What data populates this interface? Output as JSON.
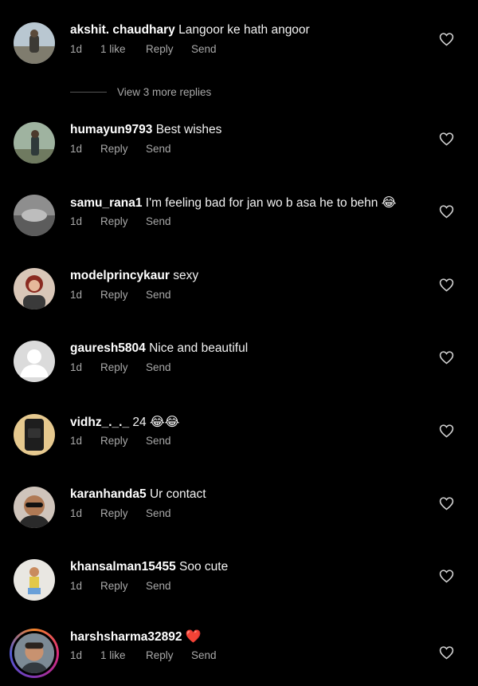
{
  "view_more_replies": "View 3 more replies",
  "comments": [
    {
      "username": "akshit. chaudhary",
      "text": "Langoor ke hath angoor",
      "time": "1d",
      "likes": "1 like",
      "reply": "Reply",
      "send": "Send"
    },
    {
      "username": "humayun9793",
      "text": "Best wishes",
      "time": "1d",
      "reply": "Reply",
      "send": "Send"
    },
    {
      "username": "samu_rana1",
      "text": "I'm feeling bad for jan wo b asa he to behn",
      "emoji": "😂",
      "time": "1d",
      "reply": "Reply",
      "send": "Send"
    },
    {
      "username": "modelprincykaur",
      "text": "sexy",
      "time": "1d",
      "reply": "Reply",
      "send": "Send"
    },
    {
      "username": "gauresh5804",
      "text": "Nice and beautiful",
      "time": "1d",
      "reply": "Reply",
      "send": "Send"
    },
    {
      "username": "vidhz_._._",
      "text": "24",
      "emoji": "😂😂",
      "time": "1d",
      "reply": "Reply",
      "send": "Send"
    },
    {
      "username": "karanhanda5",
      "text": "Ur contact",
      "time": "1d",
      "reply": "Reply",
      "send": "Send"
    },
    {
      "username": "khansalman15455",
      "text": "Soo cute",
      "time": "1d",
      "reply": "Reply",
      "send": "Send"
    },
    {
      "username": "harshsharma32892",
      "emoji": "❤️",
      "time": "1d",
      "likes": "1 like",
      "reply": "Reply",
      "send": "Send"
    }
  ],
  "colors": {
    "background": "#000000",
    "primary_text": "#ffffff",
    "secondary_text": "#a8a8a8"
  },
  "icons": {
    "like": "heart-outline-icon"
  }
}
